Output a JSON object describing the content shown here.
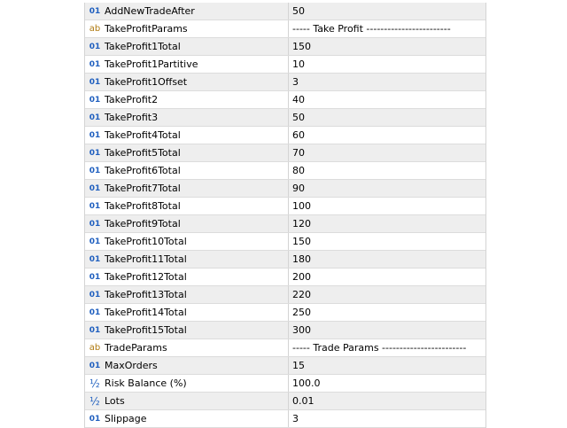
{
  "params": [
    {
      "type": "int",
      "icon": "01",
      "name": "AddNewTradeAfter",
      "value": "50"
    },
    {
      "type": "str",
      "icon": "ab",
      "name": "TakeProfitParams",
      "value": "----- Take Profit ------------------------"
    },
    {
      "type": "int",
      "icon": "01",
      "name": "TakeProfit1Total",
      "value": "150"
    },
    {
      "type": "int",
      "icon": "01",
      "name": "TakeProfit1Partitive",
      "value": "10"
    },
    {
      "type": "int",
      "icon": "01",
      "name": "TakeProfit1Offset",
      "value": "3"
    },
    {
      "type": "int",
      "icon": "01",
      "name": "TakeProfit2",
      "value": "40"
    },
    {
      "type": "int",
      "icon": "01",
      "name": "TakeProfit3",
      "value": "50"
    },
    {
      "type": "int",
      "icon": "01",
      "name": "TakeProfit4Total",
      "value": "60"
    },
    {
      "type": "int",
      "icon": "01",
      "name": "TakeProfit5Total",
      "value": "70"
    },
    {
      "type": "int",
      "icon": "01",
      "name": "TakeProfit6Total",
      "value": "80"
    },
    {
      "type": "int",
      "icon": "01",
      "name": "TakeProfit7Total",
      "value": "90"
    },
    {
      "type": "int",
      "icon": "01",
      "name": "TakeProfit8Total",
      "value": "100"
    },
    {
      "type": "int",
      "icon": "01",
      "name": "TakeProfit9Total",
      "value": "120"
    },
    {
      "type": "int",
      "icon": "01",
      "name": "TakeProfit10Total",
      "value": "150"
    },
    {
      "type": "int",
      "icon": "01",
      "name": "TakeProfit11Total",
      "value": "180"
    },
    {
      "type": "int",
      "icon": "01",
      "name": "TakeProfit12Total",
      "value": "200"
    },
    {
      "type": "int",
      "icon": "01",
      "name": "TakeProfit13Total",
      "value": "220"
    },
    {
      "type": "int",
      "icon": "01",
      "name": "TakeProfit14Total",
      "value": "250"
    },
    {
      "type": "int",
      "icon": "01",
      "name": "TakeProfit15Total",
      "value": "300"
    },
    {
      "type": "str",
      "icon": "ab",
      "name": "TradeParams",
      "value": "----- Trade Params ------------------------"
    },
    {
      "type": "int",
      "icon": "01",
      "name": "MaxOrders",
      "value": "15"
    },
    {
      "type": "dbl",
      "icon": "½",
      "name": "Risk Balance (%)",
      "value": "100.0"
    },
    {
      "type": "dbl",
      "icon": "½",
      "name": "Lots",
      "value": "0.01"
    },
    {
      "type": "int",
      "icon": "01",
      "name": "Slippage",
      "value": "3"
    }
  ]
}
